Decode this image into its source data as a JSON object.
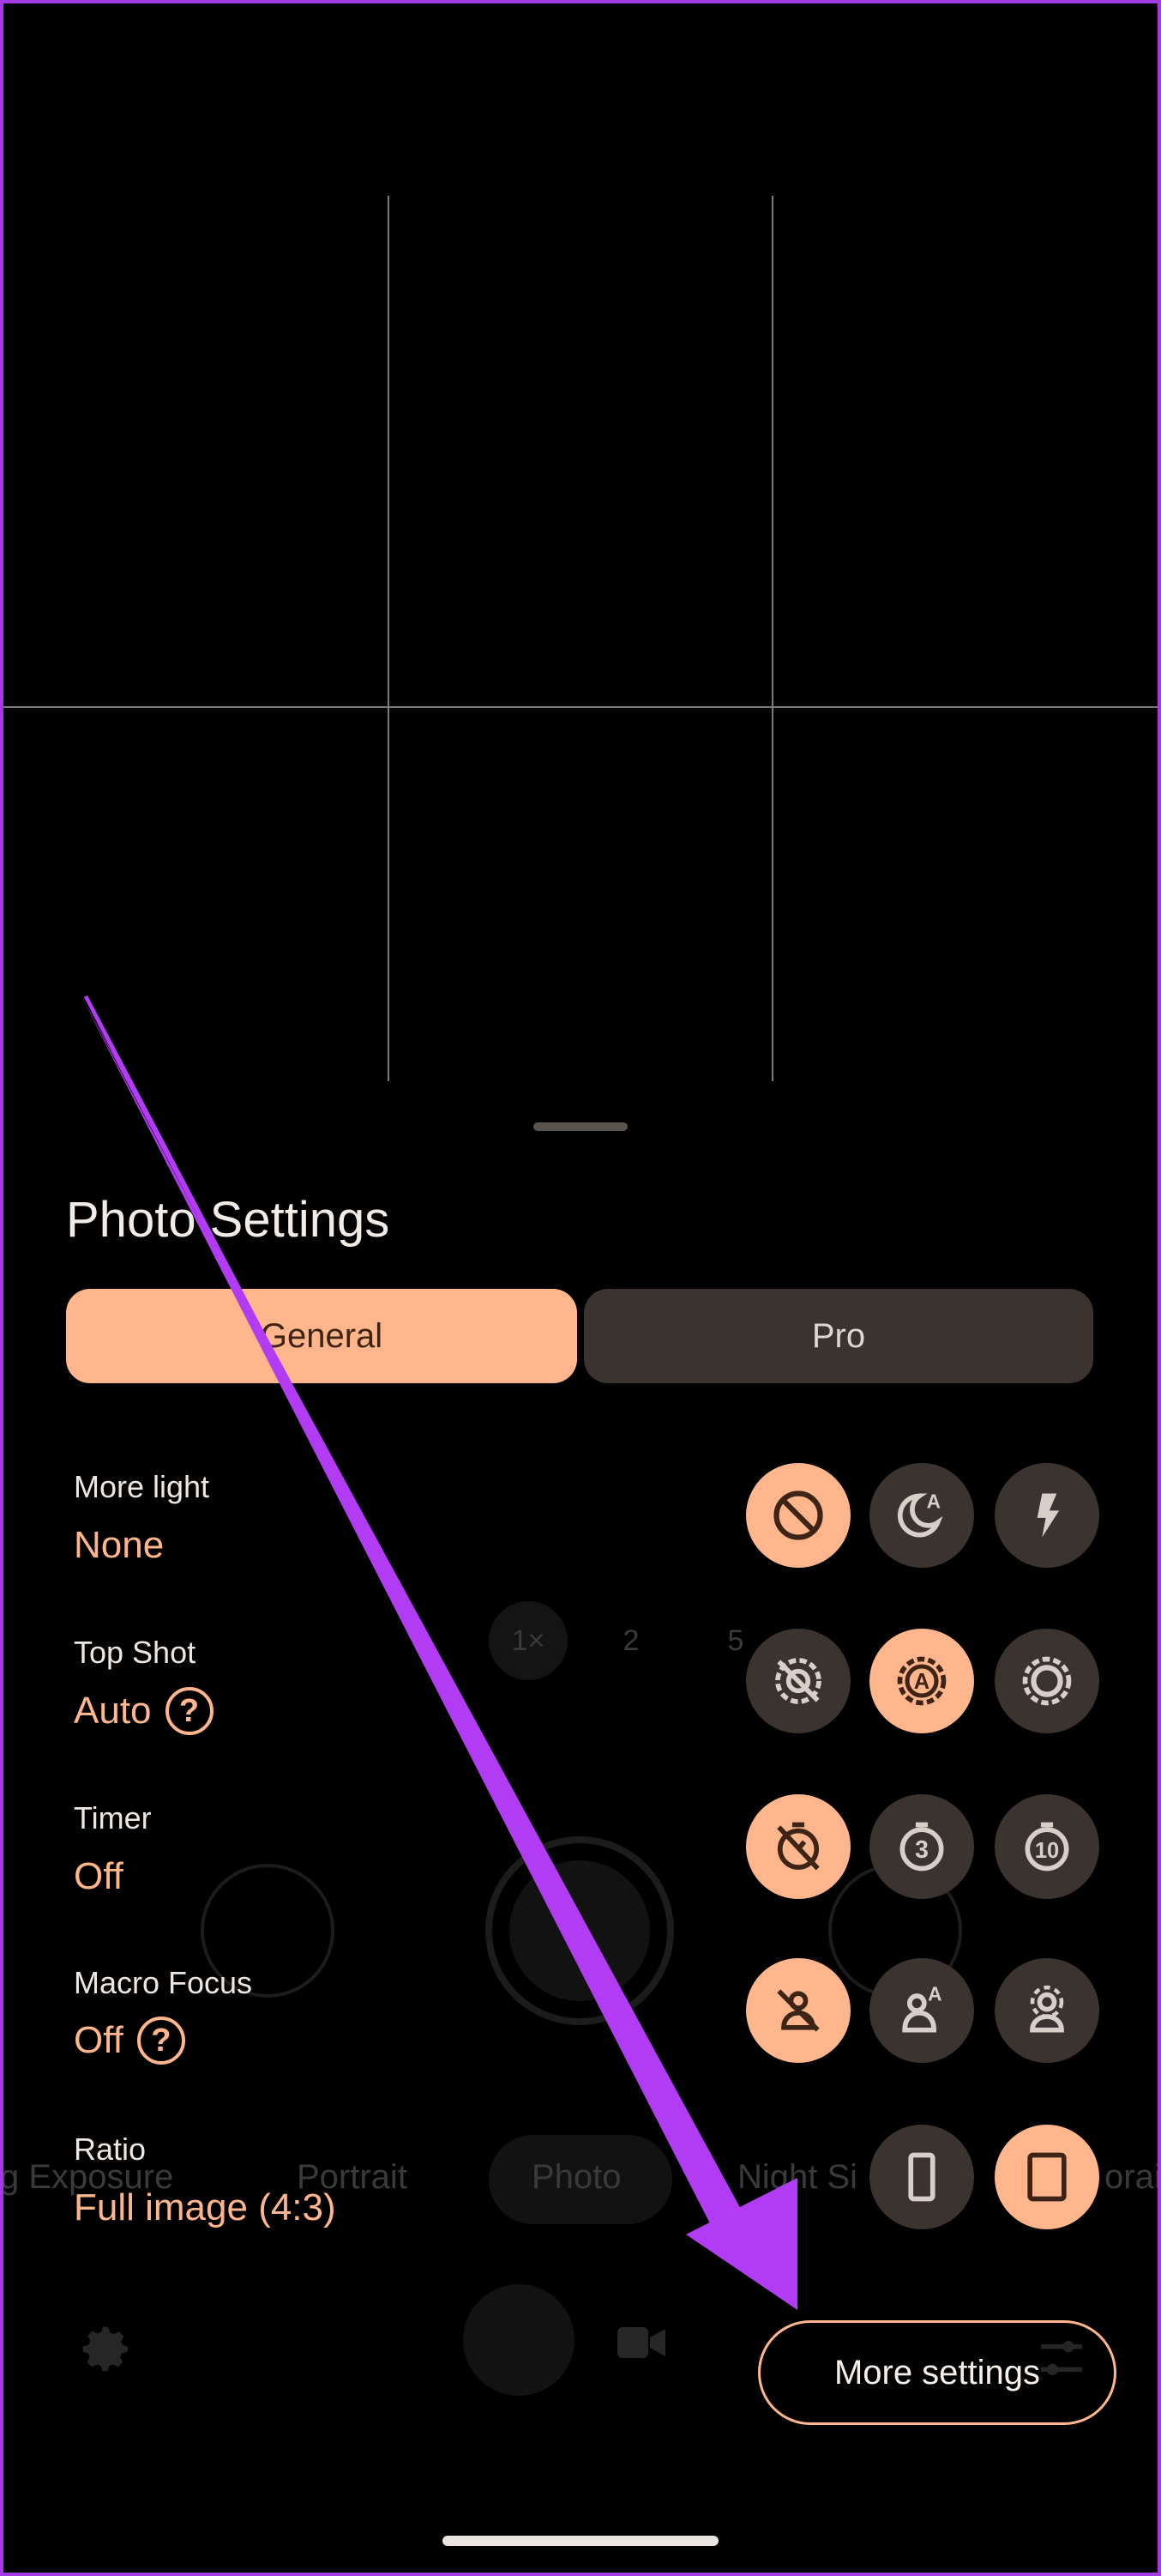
{
  "colors": {
    "accent": "#ffb68c",
    "chip_inactive": "#3a3330",
    "annotation": "#b23cf3"
  },
  "background_ui": {
    "zoom": [
      "1×",
      "2",
      "5"
    ],
    "modes": [
      "g Exposure",
      "Portrait",
      "Photo",
      "Night Si",
      "orai"
    ]
  },
  "sheet": {
    "title": "Photo Settings",
    "tabs": [
      {
        "label": "General",
        "selected": true
      },
      {
        "label": "Pro",
        "selected": false
      }
    ],
    "settings": [
      {
        "label": "More light",
        "value": "None",
        "help": false,
        "options": [
          {
            "icon": "prohibit-icon",
            "active": true
          },
          {
            "icon": "night-sight-auto-icon",
            "active": false
          },
          {
            "icon": "flash-icon",
            "active": false
          }
        ]
      },
      {
        "label": "Top Shot",
        "value": "Auto",
        "help": true,
        "options": [
          {
            "icon": "top-shot-off-icon",
            "active": false
          },
          {
            "icon": "top-shot-auto-icon",
            "active": true
          },
          {
            "icon": "top-shot-on-icon",
            "active": false
          }
        ]
      },
      {
        "label": "Timer",
        "value": "Off",
        "help": false,
        "options": [
          {
            "icon": "timer-off-icon",
            "active": true
          },
          {
            "icon": "timer-3-icon",
            "active": false
          },
          {
            "icon": "timer-10-icon",
            "active": false
          }
        ]
      },
      {
        "label": "Macro Focus",
        "value": "Off",
        "help": true,
        "options": [
          {
            "icon": "macro-off-icon",
            "active": true
          },
          {
            "icon": "macro-auto-icon",
            "active": false
          },
          {
            "icon": "macro-on-icon",
            "active": false
          }
        ]
      },
      {
        "label": "Ratio",
        "value": "Full image (4:3)",
        "help": false,
        "options": [
          {
            "icon": "ratio-tall-icon",
            "active": false
          },
          {
            "icon": "ratio-4-3-icon",
            "active": true
          }
        ]
      }
    ],
    "help_glyph": "?",
    "timer_3_digit": "3",
    "timer_10_digit": "10",
    "auto_letter": "A",
    "more_settings": "More settings"
  }
}
